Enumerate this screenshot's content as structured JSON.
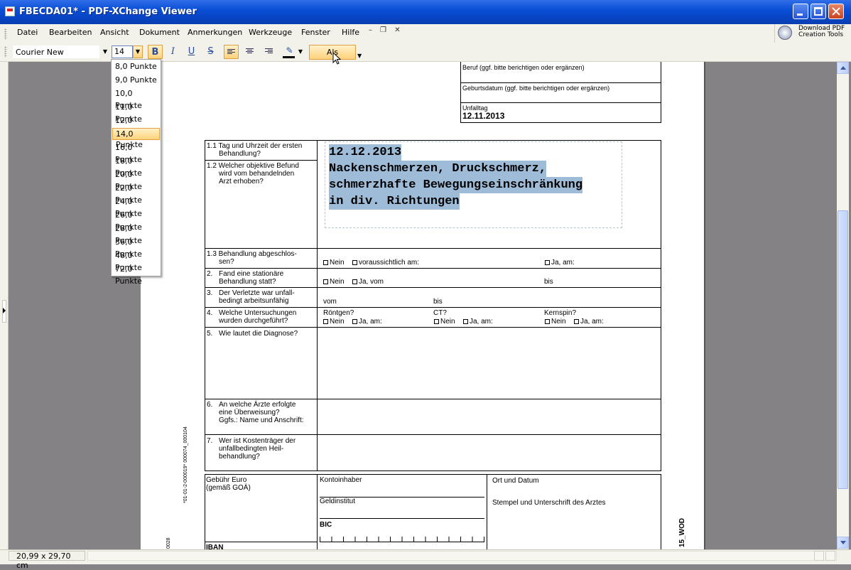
{
  "window": {
    "title": "FBECDA01* - PDF-XChange Viewer"
  },
  "menu": {
    "items": [
      "Datei",
      "Bearbeiten",
      "Ansicht",
      "Dokument",
      "Anmerkungen",
      "Werkzeuge",
      "Fenster",
      "Hilfe"
    ]
  },
  "download": {
    "line1": "Download PDF",
    "line2": "Creation Tools"
  },
  "toolbar": {
    "font_name": "Courier New",
    "font_size": "14",
    "default_label": "Als Standard",
    "text_color": "#000000"
  },
  "font_sizes": [
    "8,0 Punkte",
    "9,0 Punkte",
    "10,0 Punkte",
    "11,0 Punkte",
    "12,0 Punkte",
    "14,0 Punkte",
    "16,0 Punkte",
    "18,0 Punkte",
    "20,0 Punkte",
    "22,0 Punkte",
    "24,0 Punkte",
    "26,0 Punkte",
    "28,0 Punkte",
    "36,0 Punkte",
    "48,0 Punkte",
    "72,0 Punkte"
  ],
  "selected_font_size": "14,0 Punkte",
  "status": {
    "page_size": "20,99 x 29,70 cm"
  },
  "doc": {
    "beruf": "Beruf (ggf. bitte berichtigen oder ergänzen)",
    "geburtsdatum": "Geburtsdatum (ggf. bitte berichtigen oder ergänzen)",
    "unfalltag_label": "Unfalltag",
    "unfalltag_value": "12.11.2013",
    "q11": [
      "1.1 Tag und Uhrzeit der ersten",
      "Behandlung?"
    ],
    "q12": [
      "1.2 Welcher objektive Befund",
      "wird vom behandelnden",
      "Arzt erhoben?"
    ],
    "annotation": [
      "12.12.2013",
      "Nackenschmerzen, Druckschmerz,",
      "schmerzhafte Bewegungseinschränkung",
      "in div. Richtungen"
    ],
    "q13": [
      "1.3 Behandlung abgeschlos-",
      "sen?"
    ],
    "q13_opts": {
      "nein": "Nein",
      "vor": "voraussichtlich am:",
      "ja": "Ja, am:"
    },
    "q2": [
      "2.",
      "Fand eine stationäre",
      "Behandlung statt?"
    ],
    "q2_opts": {
      "nein": "Nein",
      "ja": "Ja, vom",
      "bis": "bis"
    },
    "q3": [
      "3.",
      "Der Verletzte war unfall-",
      "bedingt arbeitsunfähig"
    ],
    "q3_opts": {
      "vom": "vom",
      "bis": "bis"
    },
    "q4": [
      "4.",
      "Welche Untersuchungen",
      "wurden durchgeführt?"
    ],
    "q4_opts": {
      "roentgen": "Röntgen?",
      "ct": "CT?",
      "kernspin": "Kernspin?",
      "nein": "Nein",
      "ja": "Ja, am:"
    },
    "q5": [
      "5.",
      "Wie lautet die Diagnose?"
    ],
    "q6": [
      "6.",
      "An welche Ärzte erfolgte",
      "eine Überweisung?",
      "Ggfs.: Name und Anschrift:"
    ],
    "q7": [
      "7.",
      "Wer ist Kostenträger der",
      "unfallbedingten Heil-",
      "behandlung?"
    ],
    "fee": [
      "Gebühr Euro",
      "(gemäß GOÄ)"
    ],
    "kontoinhaber": "Kontoinhaber",
    "geldinstitut": "Geldinstitut",
    "bic": "BIC",
    "iban": "IBAN",
    "ort_datum": "Ort und Datum",
    "stempel": "Stempel und Unterschrift des Arztes",
    "side_code": "*01-01-2-000019* 000074_000104",
    "side_code2": "0028",
    "side_code3": "15_WOD"
  }
}
